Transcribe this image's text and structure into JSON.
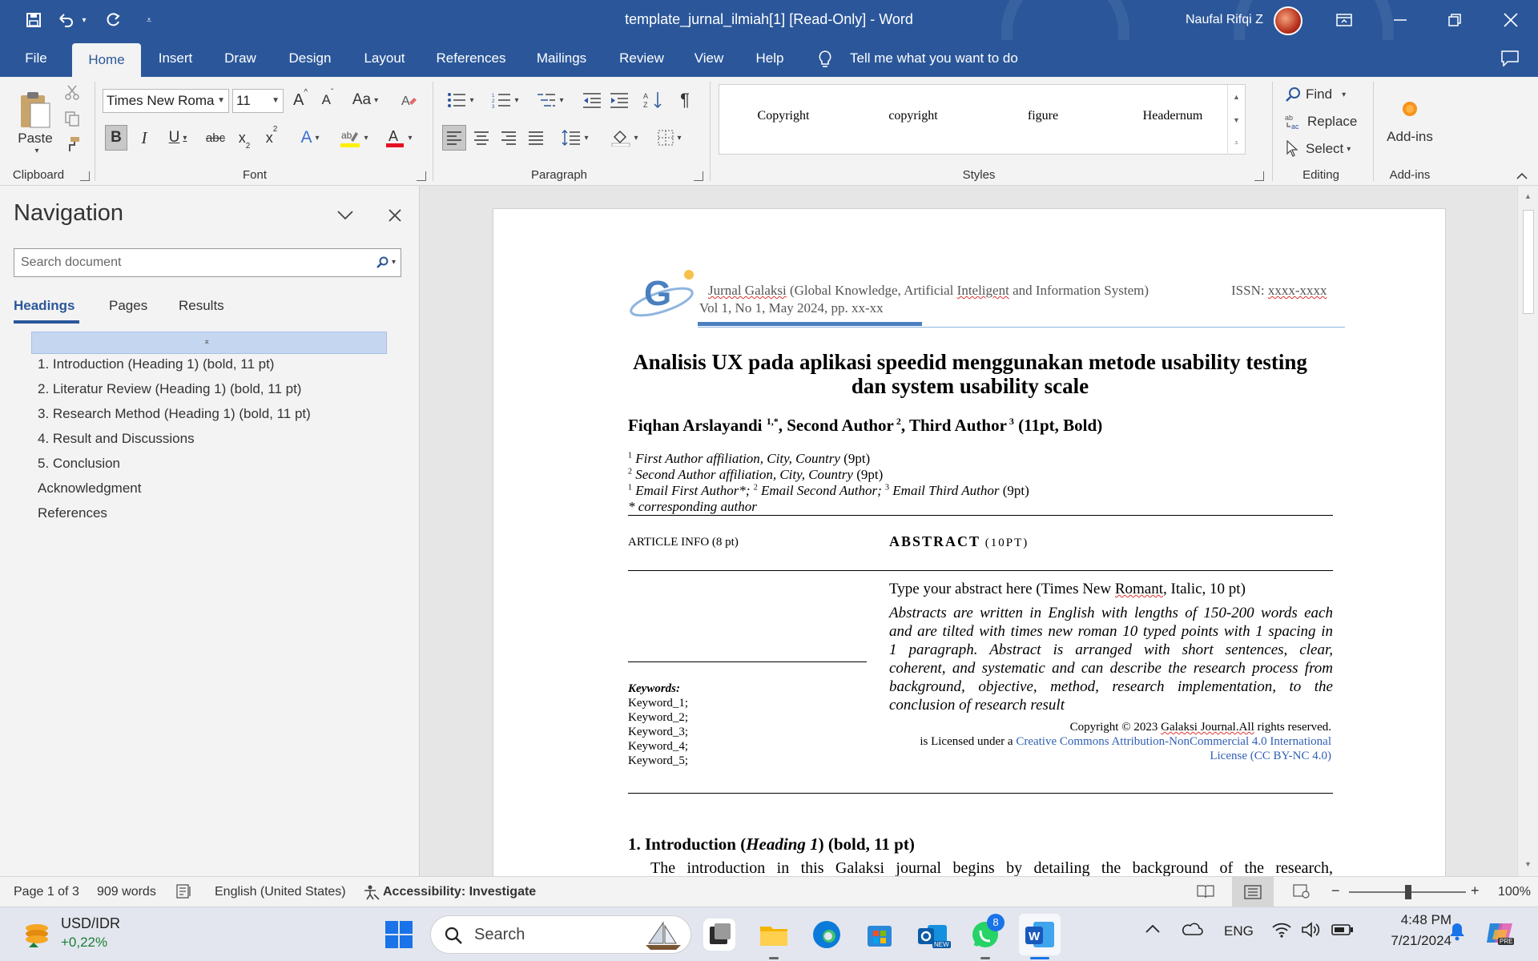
{
  "window": {
    "title": "template_jurnal_ilmiah[1] [Read-Only]  -  Word",
    "user": "Naufal Rifqi Z"
  },
  "tabs": [
    "File",
    "Home",
    "Insert",
    "Draw",
    "Design",
    "Layout",
    "References",
    "Mailings",
    "Review",
    "View",
    "Help"
  ],
  "tell_me": "Tell me what you want to do",
  "ribbon": {
    "clipboard": {
      "paste": "Paste",
      "label": "Clipboard"
    },
    "font": {
      "name": "Times New Roma",
      "size": "11",
      "label": "Font"
    },
    "paragraph": {
      "label": "Paragraph"
    },
    "styles": {
      "items": [
        "Copyright",
        "copyright",
        "figure",
        "Headernum"
      ],
      "label": "Styles"
    },
    "editing": {
      "find": "Find",
      "replace": "Replace",
      "select": "Select",
      "label": "Editing"
    },
    "addins": {
      "button": "Add-ins",
      "label": "Add-ins"
    }
  },
  "navigation": {
    "title": "Navigation",
    "search_placeholder": "Search document",
    "tabs": [
      "Headings",
      "Pages",
      "Results"
    ],
    "headings": [
      "1. Introduction (Heading 1) (bold, 11 pt)",
      "2. Literatur Review (Heading 1) (bold, 11 pt)",
      "3. Research Method (Heading 1) (bold, 11 pt)",
      "4. Result and Discussions",
      "5. Conclusion",
      "Acknowledgment",
      "References"
    ]
  },
  "document": {
    "journal_name_a": "Jurnal Galaksi",
    "journal_name_b": " (Global Knowledge, Artificial ",
    "journal_name_c": "Inteligent",
    "journal_name_d": " and Information System)",
    "issn_label": "ISSN: ",
    "issn_value": "xxxx-xxxx",
    "volume": "Vol 1, No 1, May 2024, pp. xx-xx",
    "title_line1": "Analisis UX pada aplikasi speedid menggunakan metode usability testing",
    "title_line2": "dan system usability scale",
    "author1": "Fiqhan Arslayandi ",
    "author1_sup": "1,*",
    "author2": ", Second Author",
    "author2_sup": " 2",
    "author3": ", Third Author",
    "author3_sup": " 3",
    "author_note": " (11pt, Bold)",
    "affil1_sup": "1",
    "affil1": " First Author affiliation, City, Country",
    "affil1_size": " (9pt)",
    "affil2_sup": "2",
    "affil2": " Second Author affiliation, City, Country",
    "affil2_size": " (9pt)",
    "email_sup1": "1",
    "email1": " Email First Author*; ",
    "email_sup2": "2",
    "email2": " Email Second Author; ",
    "email_sup3": "3",
    "email3": " Email Third Author",
    "email_size": " (9pt)",
    "corresponding": "* corresponding author",
    "article_info": "ARTICLE INFO (8 pt)",
    "abstract_heading": "ABSTRACT",
    "abstract_size": " (10PT)",
    "abstract_hint_a": "Type your abstract here (Times New ",
    "abstract_hint_b": "Romant",
    "abstract_hint_c": ", Italic, 10 pt)",
    "abstract_lines": [
      "Abstracts are written in English with lengths of 150-200 words each",
      "and are tilted with times new roman 10 typed points with 1 spacing in",
      "1 paragraph. Abstract is arranged with short sentences, clear,",
      "coherent, and systematic and can describe the research process from",
      "background, objective, method, research implementation, to the",
      "conclusion of research result"
    ],
    "keywords_label": "Keywords:",
    "keywords": [
      "Keyword_1;",
      "Keyword_2;",
      "Keyword_3;",
      "Keyword_4;",
      "Keyword_5;"
    ],
    "copyright_a": "Copyright © 2023 ",
    "copyright_b": "Galaksi Journal.All",
    "copyright_c": " rights reserved.",
    "license_a": "is Licensed under a ",
    "license_b": "Creative Commons Attribution-NonCommercial 4.0 International",
    "license_c": "License (CC BY-NC 4.0)",
    "section1_a": "1. Introduction (",
    "section1_b": "Heading 1",
    "section1_c": ") (bold, 11 pt)",
    "intro_line": "The introduction in this Galaksi journal begins by detailing the background of the research,"
  },
  "status": {
    "page": "Page 1 of 3",
    "words": "909 words",
    "language": "English (United States)",
    "accessibility": "Accessibility: Investigate",
    "zoom": "100%"
  },
  "taskbar": {
    "ticker_pair": "USD/IDR",
    "ticker_change": "+0,22%",
    "search": "Search",
    "whatsapp_badge": "8",
    "lang": "ENG",
    "time": "4:48 PM",
    "date": "7/21/2024",
    "outlook_badge": "NEW",
    "copilot_badge": "PRE"
  },
  "colors": {
    "word_blue": "#2b579a",
    "link_blue": "#2f5fb3",
    "ticker_green": "#1a7f37"
  }
}
